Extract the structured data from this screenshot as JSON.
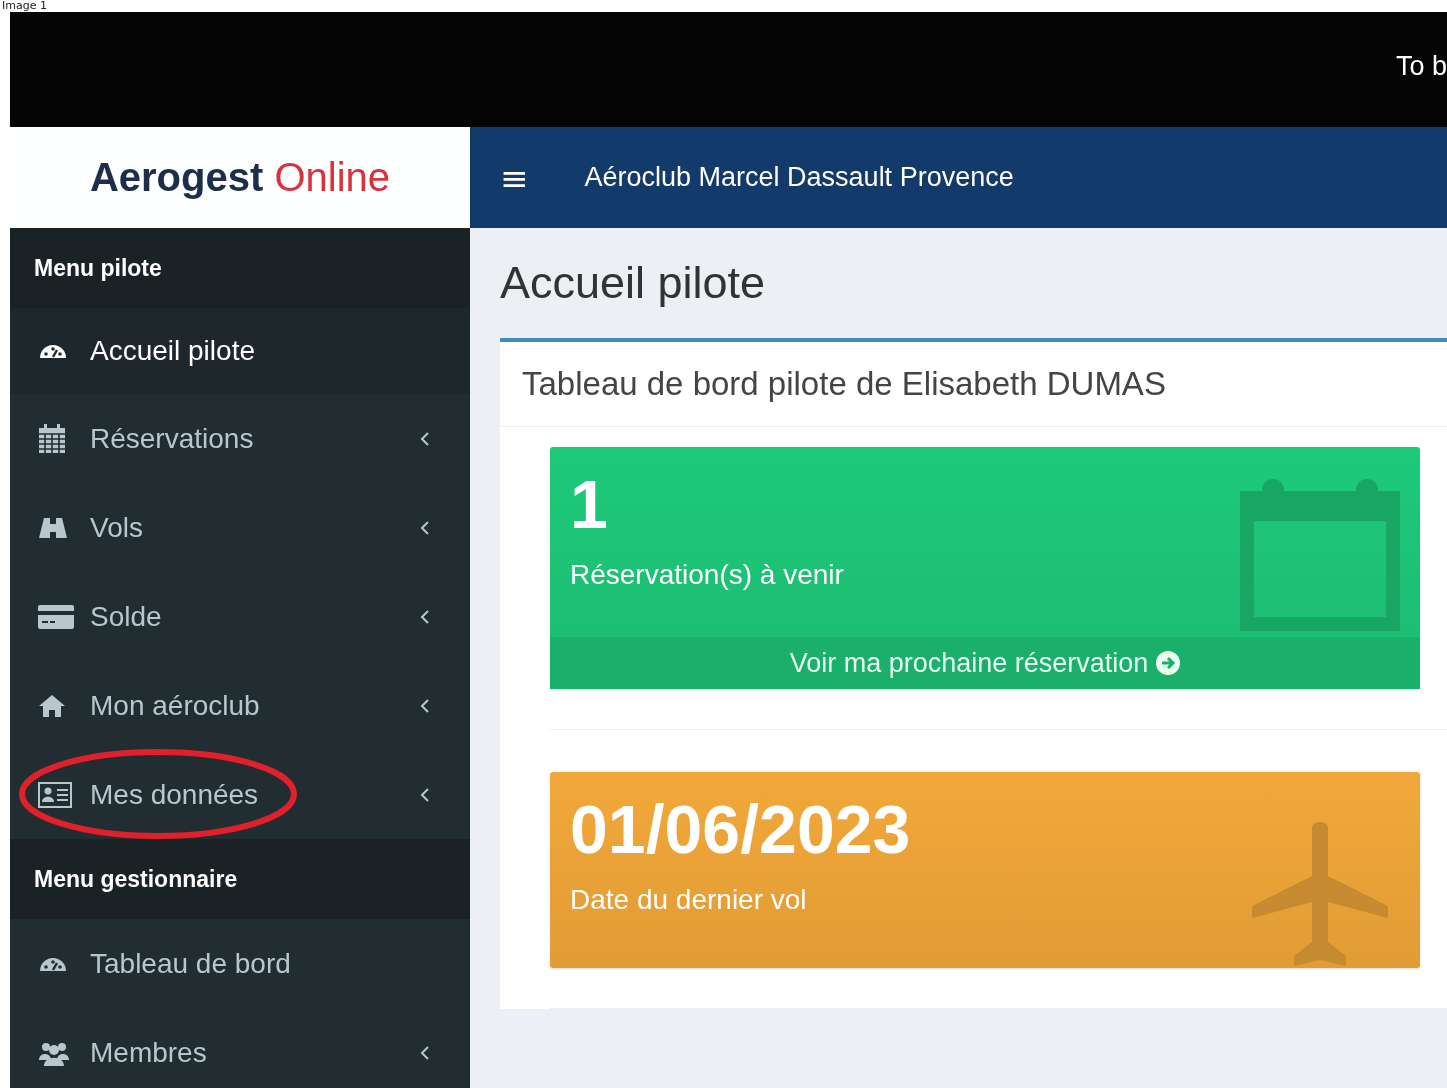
{
  "caption": "Image 1",
  "top_bar": {
    "text": "To b"
  },
  "logo": {
    "first": "Aerogest",
    "second": "Online"
  },
  "navbar": {
    "menu_icon": "≡",
    "title": "Aéroclub Marcel Dassault Provence"
  },
  "sidebar": {
    "items": [
      {
        "kind": "header",
        "label": "Menu pilote"
      },
      {
        "kind": "link",
        "label": "Accueil pilote",
        "selected": true,
        "expandable": false,
        "circled": false
      },
      {
        "kind": "link",
        "label": "Réservations",
        "selected": false,
        "expandable": true,
        "circled": false
      },
      {
        "kind": "link",
        "label": "Vols",
        "selected": false,
        "expandable": true,
        "circled": false
      },
      {
        "kind": "link",
        "label": "Solde",
        "selected": false,
        "expandable": true,
        "circled": false
      },
      {
        "kind": "link",
        "label": "Mon aéroclub",
        "selected": false,
        "expandable": true,
        "circled": false
      },
      {
        "kind": "link",
        "label": "Mes données",
        "selected": false,
        "expandable": true,
        "circled": true
      },
      {
        "kind": "header",
        "label": "Menu gestionnaire"
      },
      {
        "kind": "link",
        "label": "Tableau de bord",
        "selected": false,
        "expandable": false,
        "circled": false
      },
      {
        "kind": "link",
        "label": "Membres",
        "selected": false,
        "expandable": true,
        "circled": false
      }
    ]
  },
  "page_title": "Accueil pilote",
  "panel": {
    "title": "Tableau de bord pilote de Elisabeth DUMAS",
    "stat_boxes": [
      {
        "value": "1",
        "label": "Réservation(s) à venir",
        "color": "#1ec97a",
        "footer": "Voir ma prochaine réservation"
      },
      {
        "value": "01/06/2023",
        "label": "Date du dernier vol",
        "color": "#f2a83a"
      }
    ]
  }
}
